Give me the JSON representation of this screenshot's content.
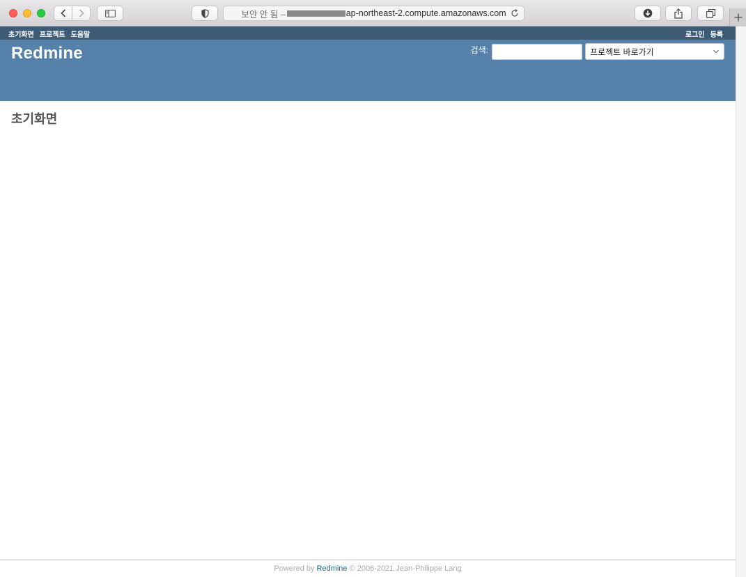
{
  "browser": {
    "security_label": "보안 안 됨 –",
    "url_host": "ap-northeast-2.compute.amazonaws.com"
  },
  "top_menu": {
    "left": [
      "초기화면",
      "프로젝트",
      "도움말"
    ],
    "right": [
      "로그인",
      "등록"
    ]
  },
  "header": {
    "site_title": "Redmine",
    "search_label": "검색:",
    "search_value": "",
    "project_jump": "프로젝트 바로가기"
  },
  "content": {
    "page_title": "초기화면"
  },
  "footer": {
    "powered_by": "Powered by",
    "redmine_link": "Redmine",
    "copyright": "© 2006-2021 Jean-Philippe Lang"
  },
  "colors": {
    "top_menu_bg": "#3e5b76",
    "header_bg": "#5581ab",
    "link": "#116699"
  },
  "icons": [
    "back-icon",
    "forward-icon",
    "sidebar-icon",
    "shield-icon",
    "reload-icon",
    "download-icon",
    "share-icon",
    "tabs-icon",
    "plus-icon",
    "chevron-down-icon"
  ]
}
